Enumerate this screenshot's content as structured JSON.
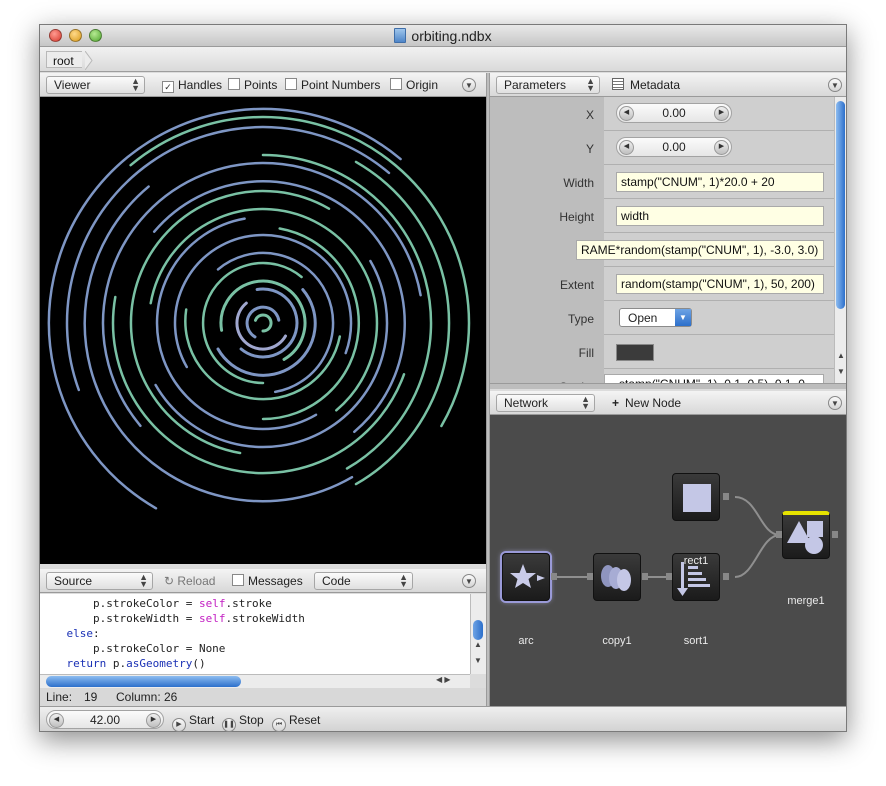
{
  "window": {
    "title": "orbiting.ndbx",
    "path": "root"
  },
  "viewer": {
    "mode": "Viewer",
    "options": [
      {
        "label": "Handles",
        "checked": true
      },
      {
        "label": "Points",
        "checked": false
      },
      {
        "label": "Point Numbers",
        "checked": false
      },
      {
        "label": "Origin",
        "checked": false
      }
    ]
  },
  "source": {
    "mode": "Source",
    "reload": "Reload",
    "messages": "Messages",
    "code_mode": "Code",
    "lines": [
      "        p.strokeColor = self.stroke",
      "        p.strokeWidth = self.strokeWidth",
      "    else:",
      "        p.strokeColor = None",
      "    return p.asGeometry()"
    ],
    "status_line_label": "Line:",
    "status_line_value": "19",
    "status_column_label": "Column:",
    "status_column_value": "26"
  },
  "parameters": {
    "mode": "Parameters",
    "metadata": "Metadata",
    "rows": [
      {
        "label": "X",
        "value": "0.00"
      },
      {
        "label": "Y",
        "value": "0.00"
      },
      {
        "label": "Width",
        "value": "stamp(\"CNUM\", 1)*20.0 + 20"
      },
      {
        "label": "Height",
        "value": "width"
      },
      {
        "label": "",
        "value": "RAME*random(stamp(\"CNUM\", 1), -3.0, 3.0)"
      },
      {
        "label": "Extent",
        "value": "random(stamp(\"CNUM\", 1), 50, 200)"
      },
      {
        "label": "Type",
        "value": "Open"
      },
      {
        "label": "Fill",
        "value": ""
      },
      {
        "label": "Stroke",
        "value": "...stamp(\"CNUM\", 1), 0.1, 0.5), 0.1, 0..."
      }
    ]
  },
  "network": {
    "mode": "Network",
    "new_node": "New Node",
    "nodes": [
      {
        "id": "arc",
        "label": "arc"
      },
      {
        "id": "copy1",
        "label": "copy1"
      },
      {
        "id": "sort1",
        "label": "sort1"
      },
      {
        "id": "rect1",
        "label": "rect1"
      },
      {
        "id": "merge1",
        "label": "merge1"
      }
    ]
  },
  "playback": {
    "frame": "42.00",
    "start": "Start",
    "stop": "Stop",
    "reset": "Reset"
  },
  "colors": {
    "arc_a": "#79c1a4",
    "arc_b": "#7e96c4",
    "arc_c": "#a0a7cf",
    "viewer_bg": "#000000",
    "network_bg": "#4b4b4b"
  }
}
